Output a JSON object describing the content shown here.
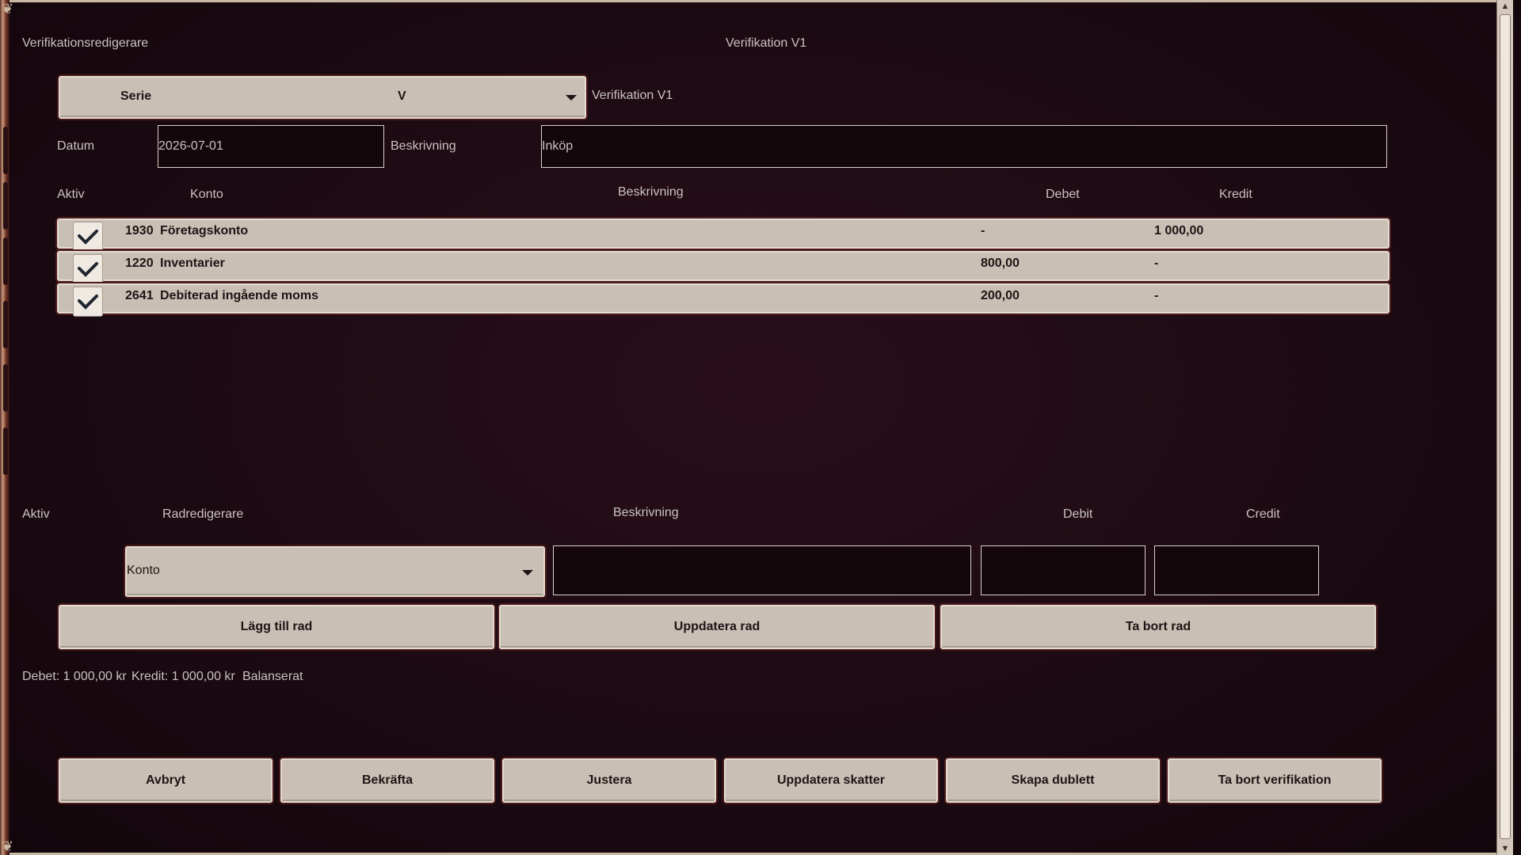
{
  "window": {
    "title_left": "Verifikationsredigerare",
    "title_center": "Verifikation V1"
  },
  "header": {
    "serie_label": "Serie",
    "serie_value": "V",
    "verification_label": "Verifikation V1",
    "datum_label": "Datum",
    "datum_value": "2026-07-01",
    "beskrivning_label": "Beskrivning",
    "beskrivning_value": "Inköp"
  },
  "table": {
    "columns": {
      "aktiv": "Aktiv",
      "konto": "Konto",
      "beskrivning": "Beskrivning",
      "debet": "Debet",
      "kredit": "Kredit"
    },
    "rows": [
      {
        "active": true,
        "account": "1930",
        "name": "Företagskonto",
        "debet": "-",
        "kredit": "1 000,00"
      },
      {
        "active": true,
        "account": "1220",
        "name": "Inventarier",
        "debet": "800,00",
        "kredit": "-"
      },
      {
        "active": true,
        "account": "2641",
        "name": "Debiterad ingående moms",
        "debet": "200,00",
        "kredit": "-"
      }
    ]
  },
  "row_editor": {
    "aktiv_label": "Aktiv",
    "title": "Radredigerare",
    "beskrivning_label": "Beskrivning",
    "debit_label": "Debit",
    "credit_label": "Credit",
    "konto_placeholder": "Konto",
    "beskrivning_value": "",
    "debit_value": "",
    "credit_value": "",
    "add_row": "Lägg till rad",
    "update_row": "Uppdatera rad",
    "delete_row": "Ta bort rad"
  },
  "summary": {
    "debet": "Debet: 1 000,00 kr",
    "kredit": "Kredit: 1 000,00 kr",
    "status": "Balanserat"
  },
  "actions": {
    "cancel": "Avbryt",
    "confirm": "Bekräfta",
    "adjust": "Justera",
    "update_taxes": "Uppdatera skatter",
    "duplicate": "Skapa dublett",
    "delete_verification": "Ta bort verifikation"
  },
  "icons": {
    "check": "check-icon",
    "dropdown": "chevron-down-icon"
  }
}
